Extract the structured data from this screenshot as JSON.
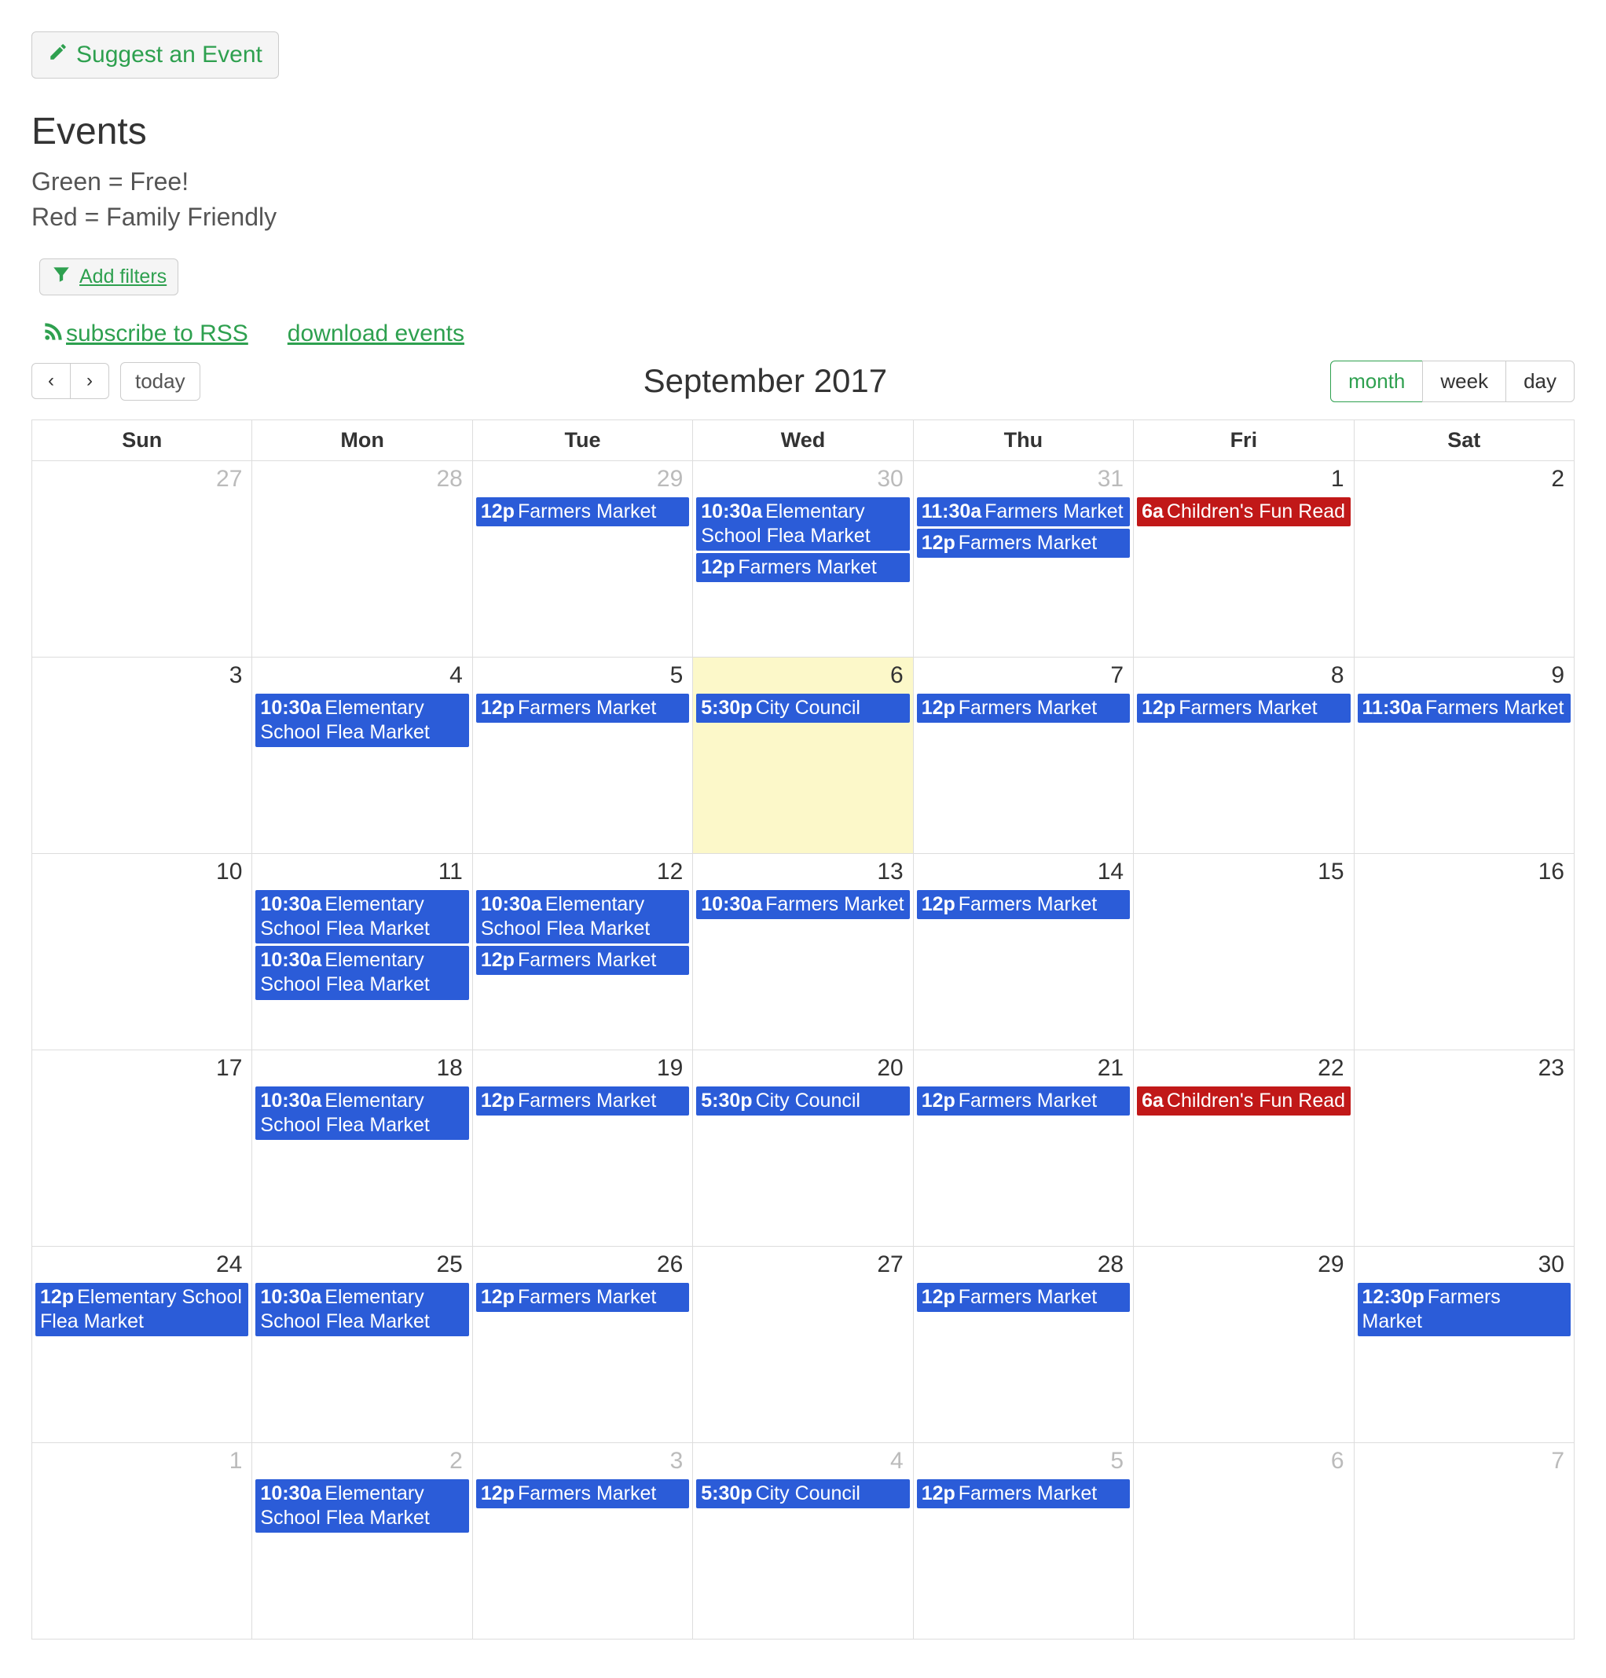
{
  "suggest_button": "Suggest an Event",
  "page_title": "Events",
  "legend_green": "Green = Free!",
  "legend_red": "Red = Family Friendly",
  "add_filters": "Add filters",
  "subscribe_rss": "subscribe to RSS",
  "download_events": "download events",
  "nav_prev": "‹",
  "nav_next": "›",
  "nav_today": "today",
  "calendar_title": "September 2017",
  "view_month": "month",
  "view_week": "week",
  "view_day": "day",
  "day_headers": [
    "Sun",
    "Mon",
    "Tue",
    "Wed",
    "Thu",
    "Fri",
    "Sat"
  ],
  "weeks": [
    [
      {
        "num": "27",
        "other": true,
        "events": []
      },
      {
        "num": "28",
        "other": true,
        "events": []
      },
      {
        "num": "29",
        "other": true,
        "events": [
          {
            "time": "12p",
            "title": "Farmers Market",
            "color": "blue"
          }
        ]
      },
      {
        "num": "30",
        "other": true,
        "events": [
          {
            "time": "10:30a",
            "title": "Elementary School Flea Market",
            "color": "blue"
          },
          {
            "time": "12p",
            "title": "Farmers Market",
            "color": "blue"
          }
        ]
      },
      {
        "num": "31",
        "other": true,
        "events": [
          {
            "time": "11:30a",
            "title": "Farmers Market",
            "color": "blue"
          },
          {
            "time": "12p",
            "title": "Farmers Market",
            "color": "blue"
          }
        ]
      },
      {
        "num": "1",
        "events": [
          {
            "time": "6a",
            "title": "Children's Fun Read",
            "color": "red"
          }
        ]
      },
      {
        "num": "2",
        "events": []
      }
    ],
    [
      {
        "num": "3",
        "events": []
      },
      {
        "num": "4",
        "events": [
          {
            "time": "10:30a",
            "title": "Elementary School Flea Market",
            "color": "blue"
          }
        ]
      },
      {
        "num": "5",
        "events": [
          {
            "time": "12p",
            "title": "Farmers Market",
            "color": "blue"
          }
        ]
      },
      {
        "num": "6",
        "today": true,
        "events": [
          {
            "time": "5:30p",
            "title": "City Council",
            "color": "blue"
          }
        ]
      },
      {
        "num": "7",
        "events": [
          {
            "time": "12p",
            "title": "Farmers Market",
            "color": "blue"
          }
        ]
      },
      {
        "num": "8",
        "events": [
          {
            "time": "12p",
            "title": "Farmers Market",
            "color": "blue"
          }
        ]
      },
      {
        "num": "9",
        "events": [
          {
            "time": "11:30a",
            "title": "Farmers Market",
            "color": "blue"
          }
        ]
      }
    ],
    [
      {
        "num": "10",
        "events": []
      },
      {
        "num": "11",
        "events": [
          {
            "time": "10:30a",
            "title": "Elementary School Flea Market",
            "color": "blue"
          },
          {
            "time": "10:30a",
            "title": "Elementary School Flea Market",
            "color": "blue"
          }
        ]
      },
      {
        "num": "12",
        "events": [
          {
            "time": "10:30a",
            "title": "Elementary School Flea Market",
            "color": "blue"
          },
          {
            "time": "12p",
            "title": "Farmers Market",
            "color": "blue"
          }
        ]
      },
      {
        "num": "13",
        "events": [
          {
            "time": "10:30a",
            "title": "Farmers Market",
            "color": "blue"
          }
        ]
      },
      {
        "num": "14",
        "events": [
          {
            "time": "12p",
            "title": "Farmers Market",
            "color": "blue"
          }
        ]
      },
      {
        "num": "15",
        "events": []
      },
      {
        "num": "16",
        "events": []
      }
    ],
    [
      {
        "num": "17",
        "events": []
      },
      {
        "num": "18",
        "events": [
          {
            "time": "10:30a",
            "title": "Elementary School Flea Market",
            "color": "blue"
          }
        ]
      },
      {
        "num": "19",
        "events": [
          {
            "time": "12p",
            "title": "Farmers Market",
            "color": "blue"
          }
        ]
      },
      {
        "num": "20",
        "events": [
          {
            "time": "5:30p",
            "title": "City Council",
            "color": "blue"
          }
        ]
      },
      {
        "num": "21",
        "events": [
          {
            "time": "12p",
            "title": "Farmers Market",
            "color": "blue"
          }
        ]
      },
      {
        "num": "22",
        "events": [
          {
            "time": "6a",
            "title": "Children's Fun Read",
            "color": "red"
          }
        ]
      },
      {
        "num": "23",
        "events": []
      }
    ],
    [
      {
        "num": "24",
        "events": [
          {
            "time": "12p",
            "title": "Elementary School Flea Market",
            "color": "blue"
          }
        ]
      },
      {
        "num": "25",
        "events": [
          {
            "time": "10:30a",
            "title": "Elementary School Flea Market",
            "color": "blue"
          }
        ]
      },
      {
        "num": "26",
        "events": [
          {
            "time": "12p",
            "title": "Farmers Market",
            "color": "blue"
          }
        ]
      },
      {
        "num": "27",
        "events": []
      },
      {
        "num": "28",
        "events": [
          {
            "time": "12p",
            "title": "Farmers Market",
            "color": "blue"
          }
        ]
      },
      {
        "num": "29",
        "events": []
      },
      {
        "num": "30",
        "events": [
          {
            "time": "12:30p",
            "title": "Farmers Market",
            "color": "blue"
          }
        ]
      }
    ],
    [
      {
        "num": "1",
        "other": true,
        "events": []
      },
      {
        "num": "2",
        "other": true,
        "events": [
          {
            "time": "10:30a",
            "title": "Elementary School Flea Market",
            "color": "blue"
          }
        ]
      },
      {
        "num": "3",
        "other": true,
        "events": [
          {
            "time": "12p",
            "title": "Farmers Market",
            "color": "blue"
          }
        ]
      },
      {
        "num": "4",
        "other": true,
        "events": [
          {
            "time": "5:30p",
            "title": "City Council",
            "color": "blue"
          }
        ]
      },
      {
        "num": "5",
        "other": true,
        "events": [
          {
            "time": "12p",
            "title": "Farmers Market",
            "color": "blue"
          }
        ]
      },
      {
        "num": "6",
        "other": true,
        "events": []
      },
      {
        "num": "7",
        "other": true,
        "events": []
      }
    ]
  ]
}
